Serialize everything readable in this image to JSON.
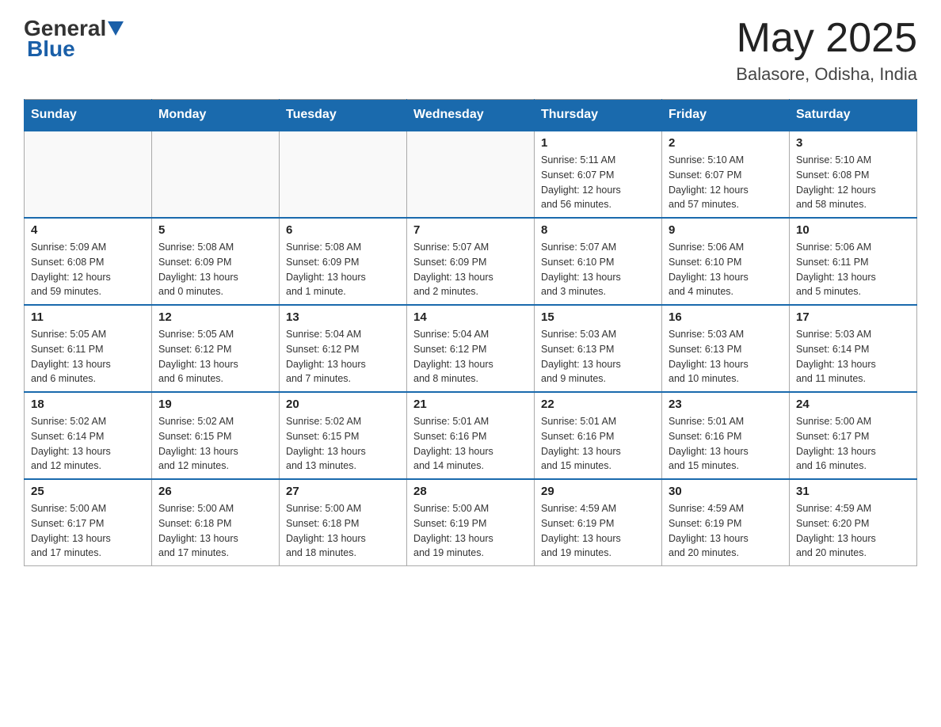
{
  "header": {
    "logo_general": "General",
    "logo_blue": "Blue",
    "month_title": "May 2025",
    "location": "Balasore, Odisha, India"
  },
  "days_of_week": [
    "Sunday",
    "Monday",
    "Tuesday",
    "Wednesday",
    "Thursday",
    "Friday",
    "Saturday"
  ],
  "weeks": [
    [
      {
        "day": "",
        "info": ""
      },
      {
        "day": "",
        "info": ""
      },
      {
        "day": "",
        "info": ""
      },
      {
        "day": "",
        "info": ""
      },
      {
        "day": "1",
        "info": "Sunrise: 5:11 AM\nSunset: 6:07 PM\nDaylight: 12 hours\nand 56 minutes."
      },
      {
        "day": "2",
        "info": "Sunrise: 5:10 AM\nSunset: 6:07 PM\nDaylight: 12 hours\nand 57 minutes."
      },
      {
        "day": "3",
        "info": "Sunrise: 5:10 AM\nSunset: 6:08 PM\nDaylight: 12 hours\nand 58 minutes."
      }
    ],
    [
      {
        "day": "4",
        "info": "Sunrise: 5:09 AM\nSunset: 6:08 PM\nDaylight: 12 hours\nand 59 minutes."
      },
      {
        "day": "5",
        "info": "Sunrise: 5:08 AM\nSunset: 6:09 PM\nDaylight: 13 hours\nand 0 minutes."
      },
      {
        "day": "6",
        "info": "Sunrise: 5:08 AM\nSunset: 6:09 PM\nDaylight: 13 hours\nand 1 minute."
      },
      {
        "day": "7",
        "info": "Sunrise: 5:07 AM\nSunset: 6:09 PM\nDaylight: 13 hours\nand 2 minutes."
      },
      {
        "day": "8",
        "info": "Sunrise: 5:07 AM\nSunset: 6:10 PM\nDaylight: 13 hours\nand 3 minutes."
      },
      {
        "day": "9",
        "info": "Sunrise: 5:06 AM\nSunset: 6:10 PM\nDaylight: 13 hours\nand 4 minutes."
      },
      {
        "day": "10",
        "info": "Sunrise: 5:06 AM\nSunset: 6:11 PM\nDaylight: 13 hours\nand 5 minutes."
      }
    ],
    [
      {
        "day": "11",
        "info": "Sunrise: 5:05 AM\nSunset: 6:11 PM\nDaylight: 13 hours\nand 6 minutes."
      },
      {
        "day": "12",
        "info": "Sunrise: 5:05 AM\nSunset: 6:12 PM\nDaylight: 13 hours\nand 6 minutes."
      },
      {
        "day": "13",
        "info": "Sunrise: 5:04 AM\nSunset: 6:12 PM\nDaylight: 13 hours\nand 7 minutes."
      },
      {
        "day": "14",
        "info": "Sunrise: 5:04 AM\nSunset: 6:12 PM\nDaylight: 13 hours\nand 8 minutes."
      },
      {
        "day": "15",
        "info": "Sunrise: 5:03 AM\nSunset: 6:13 PM\nDaylight: 13 hours\nand 9 minutes."
      },
      {
        "day": "16",
        "info": "Sunrise: 5:03 AM\nSunset: 6:13 PM\nDaylight: 13 hours\nand 10 minutes."
      },
      {
        "day": "17",
        "info": "Sunrise: 5:03 AM\nSunset: 6:14 PM\nDaylight: 13 hours\nand 11 minutes."
      }
    ],
    [
      {
        "day": "18",
        "info": "Sunrise: 5:02 AM\nSunset: 6:14 PM\nDaylight: 13 hours\nand 12 minutes."
      },
      {
        "day": "19",
        "info": "Sunrise: 5:02 AM\nSunset: 6:15 PM\nDaylight: 13 hours\nand 12 minutes."
      },
      {
        "day": "20",
        "info": "Sunrise: 5:02 AM\nSunset: 6:15 PM\nDaylight: 13 hours\nand 13 minutes."
      },
      {
        "day": "21",
        "info": "Sunrise: 5:01 AM\nSunset: 6:16 PM\nDaylight: 13 hours\nand 14 minutes."
      },
      {
        "day": "22",
        "info": "Sunrise: 5:01 AM\nSunset: 6:16 PM\nDaylight: 13 hours\nand 15 minutes."
      },
      {
        "day": "23",
        "info": "Sunrise: 5:01 AM\nSunset: 6:16 PM\nDaylight: 13 hours\nand 15 minutes."
      },
      {
        "day": "24",
        "info": "Sunrise: 5:00 AM\nSunset: 6:17 PM\nDaylight: 13 hours\nand 16 minutes."
      }
    ],
    [
      {
        "day": "25",
        "info": "Sunrise: 5:00 AM\nSunset: 6:17 PM\nDaylight: 13 hours\nand 17 minutes."
      },
      {
        "day": "26",
        "info": "Sunrise: 5:00 AM\nSunset: 6:18 PM\nDaylight: 13 hours\nand 17 minutes."
      },
      {
        "day": "27",
        "info": "Sunrise: 5:00 AM\nSunset: 6:18 PM\nDaylight: 13 hours\nand 18 minutes."
      },
      {
        "day": "28",
        "info": "Sunrise: 5:00 AM\nSunset: 6:19 PM\nDaylight: 13 hours\nand 19 minutes."
      },
      {
        "day": "29",
        "info": "Sunrise: 4:59 AM\nSunset: 6:19 PM\nDaylight: 13 hours\nand 19 minutes."
      },
      {
        "day": "30",
        "info": "Sunrise: 4:59 AM\nSunset: 6:19 PM\nDaylight: 13 hours\nand 20 minutes."
      },
      {
        "day": "31",
        "info": "Sunrise: 4:59 AM\nSunset: 6:20 PM\nDaylight: 13 hours\nand 20 minutes."
      }
    ]
  ]
}
